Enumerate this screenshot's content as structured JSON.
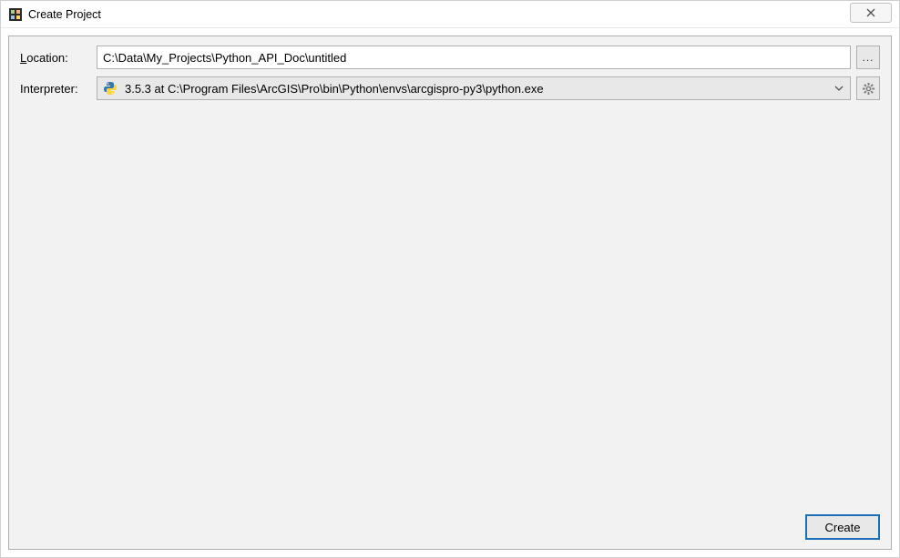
{
  "window": {
    "title": "Create Project"
  },
  "form": {
    "location_label_prefix": "L",
    "location_label_rest": "ocation:",
    "location_value": "C:\\Data\\My_Projects\\Python_API_Doc\\untitled",
    "browse_label": "...",
    "interpreter_label": "Interpreter:",
    "interpreter_value": "3.5.3 at C:\\Program Files\\ArcGIS\\Pro\\bin\\Python\\envs\\arcgispro-py3\\python.exe"
  },
  "buttons": {
    "create": "Create"
  }
}
